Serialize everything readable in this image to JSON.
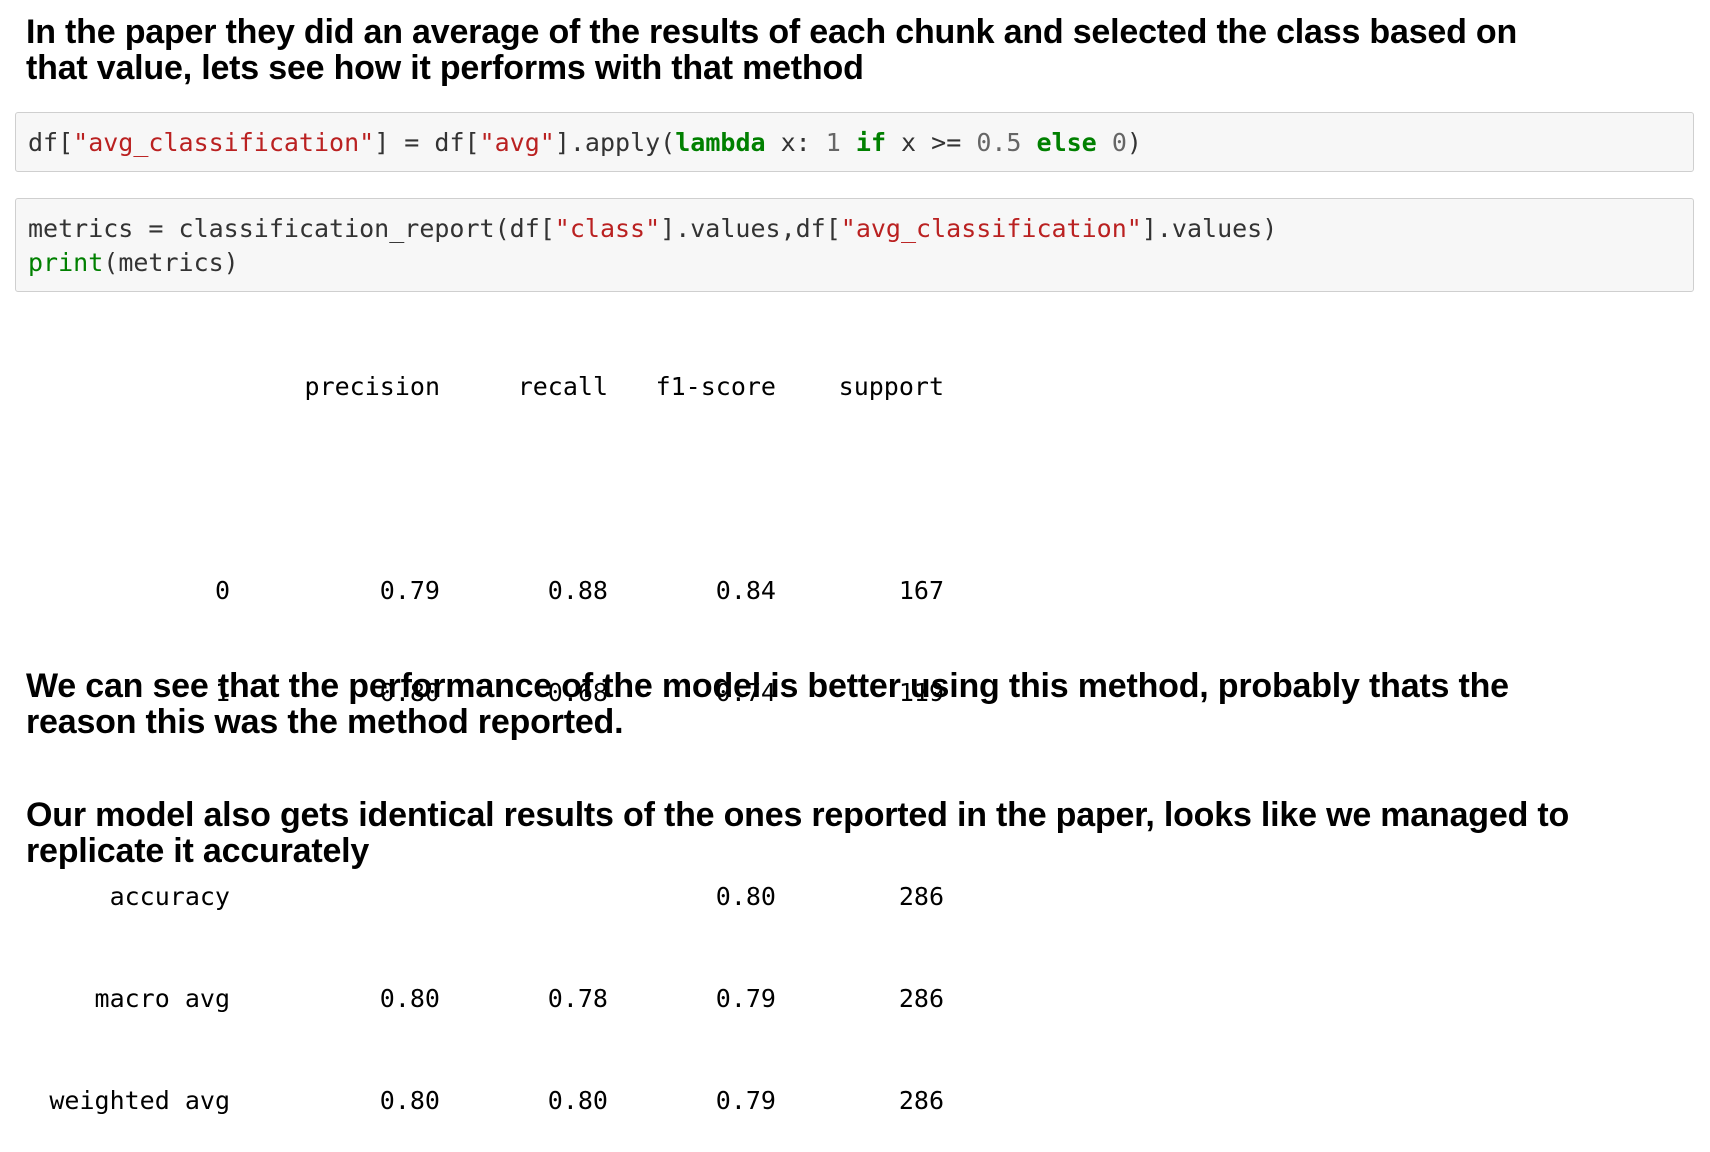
{
  "headings": {
    "intro_line1": "In the paper they did an average of the results of each chunk and selected the class based on",
    "intro_line2": "that value, lets see how it performs with that method",
    "conclusion1_line1": "We can see that the performance of the model is better using this method, probably thats the",
    "conclusion1_line2": "reason this was the method reported.",
    "conclusion2_line1": "Our model also gets identical results of the ones reported in the paper, looks like we managed to",
    "conclusion2_line2": "replicate it accurately"
  },
  "cell1": {
    "t1": "df[",
    "s1": "\"avg_classification\"",
    "t2": "] = df[",
    "s2": "\"avg\"",
    "t3": "].apply(",
    "k1": "lambda",
    "t4": " x: ",
    "n1": "1",
    "t5": " ",
    "k2": "if",
    "t6": " x >= ",
    "n2": "0.5",
    "t7": " ",
    "k3": "else",
    "t8": " ",
    "n3": "0",
    "t9": ")"
  },
  "cell2": {
    "line1_t1": "metrics = classification_report(df[",
    "line1_s1": "\"class\"",
    "line1_t2": "].values,df[",
    "line1_s2": "\"avg_classification\"",
    "line1_t3": "].values)",
    "line2_b1": "print",
    "line2_t1": "(metrics)"
  },
  "report": {
    "header": [
      "",
      "precision",
      "recall",
      "f1-score",
      "support"
    ],
    "rows": [
      [
        "0",
        "0.79",
        "0.88",
        "0.84",
        "167"
      ],
      [
        "1",
        "0.80",
        "0.68",
        "0.74",
        "119"
      ]
    ],
    "summary": [
      [
        "accuracy",
        "",
        "",
        "0.80",
        "286"
      ],
      [
        "macro avg",
        "0.80",
        "0.78",
        "0.79",
        "286"
      ],
      [
        "weighted avg",
        "0.80",
        "0.80",
        "0.79",
        "286"
      ]
    ]
  }
}
